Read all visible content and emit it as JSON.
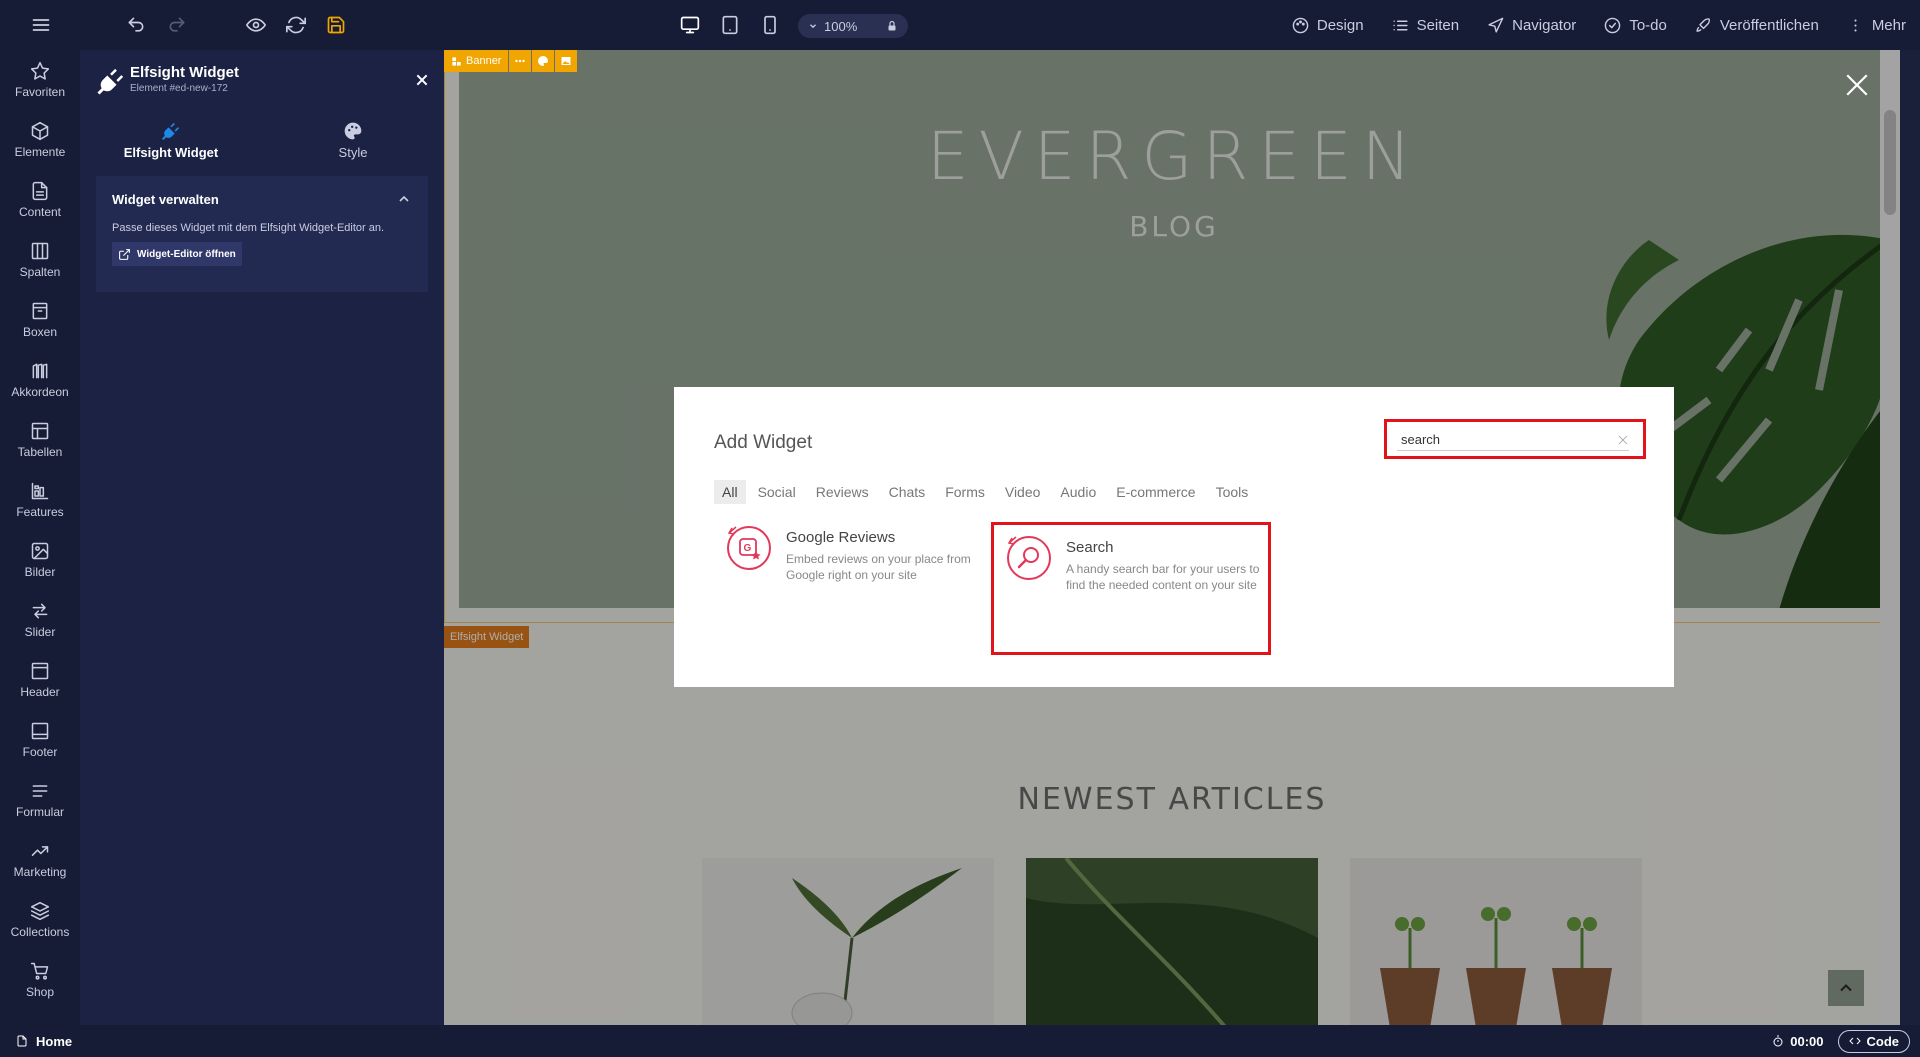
{
  "toolbar": {
    "zoom": "100%",
    "nav": [
      "Design",
      "Seiten",
      "Navigator",
      "To-do",
      "Veröffentlichen",
      "Mehr"
    ]
  },
  "sidebar": {
    "items": [
      {
        "label": "Favoriten",
        "icon": "star-icon"
      },
      {
        "label": "Elemente",
        "icon": "cube-icon"
      },
      {
        "label": "Content",
        "icon": "document-icon"
      },
      {
        "label": "Spalten",
        "icon": "columns-icon"
      },
      {
        "label": "Boxen",
        "icon": "box-icon"
      },
      {
        "label": "Akkordeon",
        "icon": "accordion-icon"
      },
      {
        "label": "Tabellen",
        "icon": "table-icon"
      },
      {
        "label": "Features",
        "icon": "features-icon"
      },
      {
        "label": "Bilder",
        "icon": "image-icon"
      },
      {
        "label": "Slider",
        "icon": "slider-icon"
      },
      {
        "label": "Header",
        "icon": "header-icon"
      },
      {
        "label": "Footer",
        "icon": "footer-icon"
      },
      {
        "label": "Formular",
        "icon": "form-icon"
      },
      {
        "label": "Marketing",
        "icon": "trend-icon"
      },
      {
        "label": "Collections",
        "icon": "layers-icon"
      },
      {
        "label": "Shop",
        "icon": "cart-icon"
      }
    ]
  },
  "panel": {
    "title": "Elfsight Widget",
    "subtitle": "Element #ed-new-172",
    "tabs": [
      "Elfsight Widget",
      "Style"
    ],
    "accordion_title": "Widget verwalten",
    "accordion_text": "Passe dieses Widget mit dem Elfsight Widget-Editor an.",
    "editor_button": "Widget-Editor öffnen"
  },
  "canvas": {
    "banner_tag": "Banner",
    "hero_title": "EVERGREEN",
    "hero_subtitle": "BLOG",
    "widget_tag": "Elfsight Widget",
    "section_title": "NEWEST ARTICLES"
  },
  "modal": {
    "title": "Add Widget",
    "search_value": "search",
    "categories": [
      "All",
      "Social",
      "Reviews",
      "Chats",
      "Forms",
      "Video",
      "Audio",
      "E-commerce",
      "Tools"
    ],
    "widgets": [
      {
        "name": "Google Reviews",
        "desc": "Embed reviews on your place from Google right on your site"
      },
      {
        "name": "Search",
        "desc": "A handy search bar for your users to find the needed content on your site"
      }
    ]
  },
  "status": {
    "page": "Home",
    "timer": "00:00",
    "code": "Code"
  },
  "colors": {
    "accent": "#f0a500",
    "highlight": "#e1141a",
    "brand_blue": "#1e88e5",
    "widget_pink": "#e2395b"
  }
}
